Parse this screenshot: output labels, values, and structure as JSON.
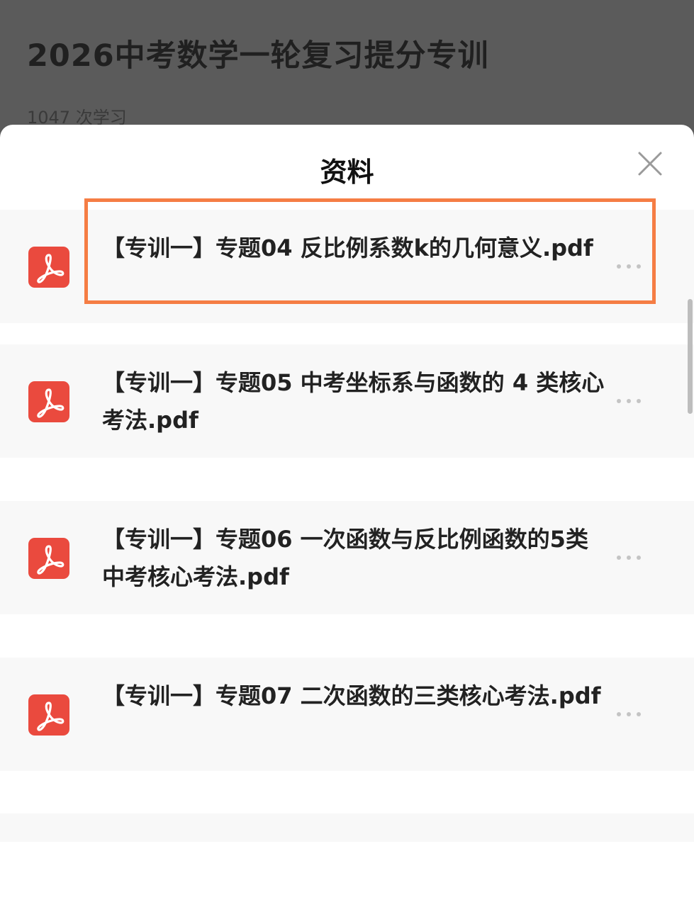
{
  "course": {
    "title": "2026中考数学一轮复习提分专训",
    "meta": "1047 次学习"
  },
  "sheet": {
    "title": "资料",
    "close_icon": "close-icon"
  },
  "files": [
    {
      "name": "【专训一】专题04 反比例系数k的几何意义.pdf",
      "icon": "pdf-icon",
      "highlighted": true
    },
    {
      "name": "【专训一】专题05 中考坐标系与函数的 4 类核心考法.pdf",
      "icon": "pdf-icon",
      "highlighted": false
    },
    {
      "name": "【专训一】专题06 一次函数与反比例函数的5类中考核心考法.pdf",
      "icon": "pdf-icon",
      "highlighted": false
    },
    {
      "name": "【专训一】专题07 二次函数的三类核心考法.pdf",
      "icon": "pdf-icon",
      "highlighted": false
    }
  ],
  "colors": {
    "pdf_red": "#ea4a3e",
    "highlight_orange": "#f57d44",
    "row_bg": "#f8f8f8",
    "backdrop": "#5b5b5b"
  }
}
